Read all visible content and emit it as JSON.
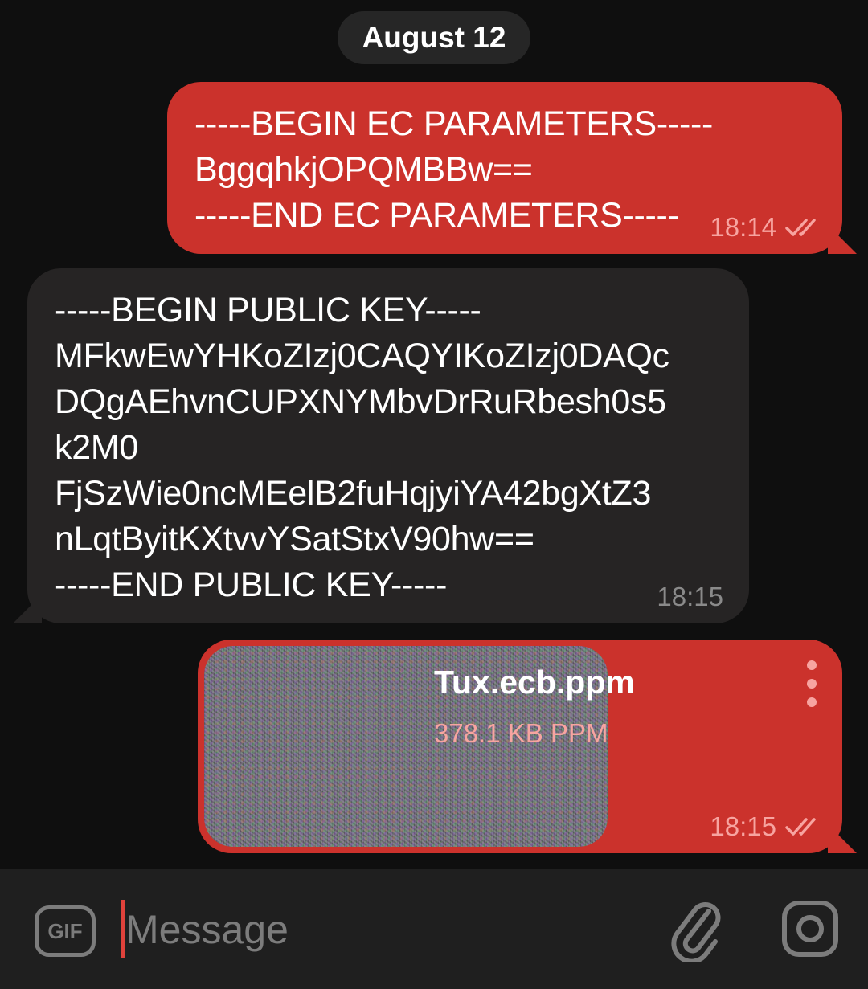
{
  "date_separator": "August 12",
  "messages": [
    {
      "direction": "outgoing",
      "text": "-----BEGIN EC PARAMETERS-----\nBggqhkjOPQMBBw==\n-----END EC PARAMETERS-----",
      "time": "18:14",
      "status_icon": "double-check-icon"
    },
    {
      "direction": "incoming",
      "text": "-----BEGIN PUBLIC KEY-----\nMFkwEwYHKoZIzj0CAQYIKoZIzj0DAQc\nDQgAEhvnCUPXNYMbvDrRuRbesh0s5\nk2M0\nFjSzWie0ncMEelB2fuHqjyiYA42bgXtZ3\nnLqtByitKXtvvYSatStxV90hw==\n-----END PUBLIC KEY-----",
      "time": "18:15"
    },
    {
      "direction": "outgoing",
      "type": "file",
      "file_name": "Tux.ecb.ppm",
      "file_size": "378.1 KB PPM",
      "time": "18:15",
      "status_icon": "double-check-icon"
    }
  ],
  "input_bar": {
    "gif_label": "GIF",
    "placeholder": "Message",
    "attach_icon": "paperclip-icon",
    "camera_icon": "camera-icon"
  },
  "colors": {
    "background": "#0f0f0f",
    "outgoing_bubble": "#cb322c",
    "incoming_bubble": "#262424",
    "input_bar": "#1f1f1f",
    "caret": "#e0423b"
  }
}
